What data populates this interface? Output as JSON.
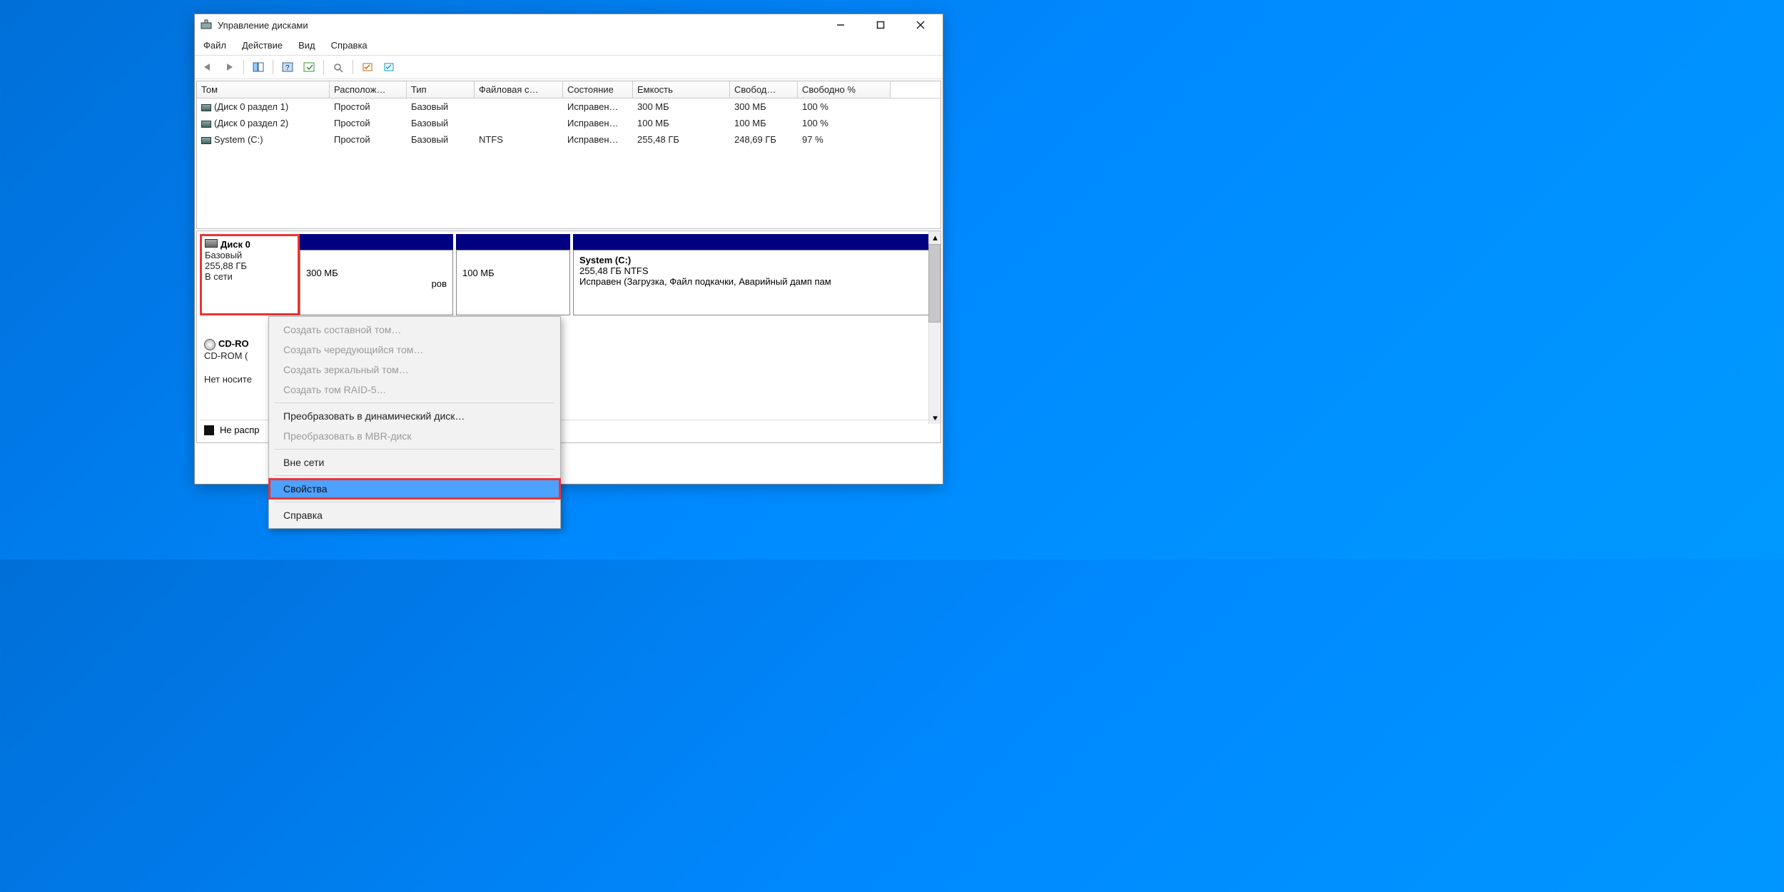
{
  "window": {
    "title": "Управление дисками"
  },
  "menu": {
    "file": "Файл",
    "action": "Действие",
    "view": "Вид",
    "help": "Справка"
  },
  "volumes": {
    "headers": {
      "tom": "Том",
      "layout": "Располож…",
      "type": "Тип",
      "fs": "Файловая с…",
      "state": "Состояние",
      "capacity": "Емкость",
      "free": "Свобод…",
      "freepct": "Свободно %"
    },
    "rows": [
      {
        "name": "(Диск 0 раздел 1)",
        "layout": "Простой",
        "type": "Базовый",
        "fs": "",
        "state": "Исправен…",
        "cap": "300 МБ",
        "free": "300 МБ",
        "pct": "100 %"
      },
      {
        "name": "(Диск 0 раздел 2)",
        "layout": "Простой",
        "type": "Базовый",
        "fs": "",
        "state": "Исправен…",
        "cap": "100 МБ",
        "free": "100 МБ",
        "pct": "100 %"
      },
      {
        "name": "System (C:)",
        "layout": "Простой",
        "type": "Базовый",
        "fs": "NTFS",
        "state": "Исправен…",
        "cap": "255,48 ГБ",
        "free": "248,69 ГБ",
        "pct": "97 %"
      }
    ]
  },
  "disk0": {
    "title": "Диск 0",
    "type": "Базовый",
    "size": "255,88 ГБ",
    "status": "В сети",
    "p1": {
      "size": "300 МБ",
      "state_tail": "ров"
    },
    "p2": {
      "size": "100 МБ"
    },
    "p3": {
      "title": "System  (C:)",
      "line2": "255,48 ГБ NTFS",
      "line3": "Исправен (Загрузка, Файл подкачки, Аварийный дамп пам"
    }
  },
  "cdrom": {
    "title": "CD-RO",
    "sub": "CD-ROM (",
    "state": "Нет носите"
  },
  "legend": {
    "unalloc": "Не распр"
  },
  "ctx": {
    "i1": "Создать составной том…",
    "i2": "Создать чередующийся том…",
    "i3": "Создать зеркальный том…",
    "i4": "Создать том RAID-5…",
    "i5": "Преобразовать в динамический диск…",
    "i6": "Преобразовать в MBR-диск",
    "i7": "Вне сети",
    "i8": "Свойства",
    "i9": "Справка"
  }
}
